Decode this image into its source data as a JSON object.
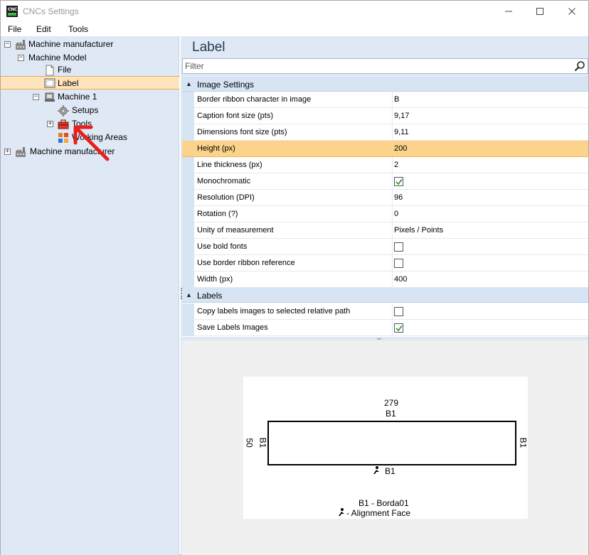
{
  "window": {
    "title": "CNCs Settings",
    "app_icon_text": "CNC",
    "controls": [
      "minimize",
      "maximize",
      "close"
    ]
  },
  "menu": {
    "items": [
      {
        "label": "File"
      },
      {
        "label": "Edit"
      },
      {
        "label": "Tools"
      }
    ]
  },
  "tree": {
    "nodes": [
      {
        "label": "Machine manufacturer",
        "expander": "−",
        "icon": "factory-icon"
      },
      {
        "label": "Machine Model",
        "expander": "−"
      },
      {
        "label": "File",
        "icon": "file-icon"
      },
      {
        "label": "Label",
        "icon": "label-icon",
        "selected": true
      },
      {
        "label": "Machine 1",
        "expander": "−",
        "icon": "machine-icon"
      },
      {
        "label": "Setups",
        "icon": "gear-icon"
      },
      {
        "label": "Tools",
        "expander": "+",
        "icon": "toolbox-icon"
      },
      {
        "label": "Working Areas",
        "icon": "working-areas-icon"
      },
      {
        "label": "Machine manufacturer",
        "expander": "+",
        "icon": "factory-icon"
      }
    ]
  },
  "panel": {
    "title": "Label",
    "filter_placeholder": "Filter"
  },
  "property_grid": {
    "categories": [
      {
        "name": "Image Settings",
        "properties": [
          {
            "name": "Border ribbon character in image",
            "value": "B"
          },
          {
            "name": "Caption font size (pts)",
            "value": "9,17"
          },
          {
            "name": "Dimensions font size (pts)",
            "value": "9,11"
          },
          {
            "name": "Height (px)",
            "value": "200",
            "highlighted": true
          },
          {
            "name": "Line thickness (px)",
            "value": "2"
          },
          {
            "name": "Monochromatic",
            "checkbox": true,
            "checked": true
          },
          {
            "name": "Resolution (DPI)",
            "value": "96"
          },
          {
            "name": "Rotation (?)",
            "value": "0"
          },
          {
            "name": "Unity of measurement",
            "value": "Pixels / Points"
          },
          {
            "name": "Use bold fonts",
            "checkbox": true,
            "checked": false
          },
          {
            "name": "Use border ribbon reference",
            "checkbox": true,
            "checked": false
          },
          {
            "name": "Width (px)",
            "value": "400"
          }
        ]
      },
      {
        "name": "Labels",
        "properties": [
          {
            "name": "Copy labels images to selected relative path",
            "checkbox": true,
            "checked": false
          },
          {
            "name": "Save Labels Images",
            "checkbox": true,
            "checked": true
          }
        ]
      }
    ]
  },
  "preview": {
    "width_dim": "279",
    "top_ribbon": "B1",
    "height_dim": "50",
    "left_ribbon": "B1",
    "right_ribbon": "B1",
    "bottom_ribbon": "B1",
    "caption": "B1 - Borda01",
    "alignment": "- Alignment Face"
  },
  "colors": {
    "panel_bg": "#dfe8f5",
    "selected_bg": "#fde4bd",
    "highlight_row": "#fbd38a",
    "checkbox_green": "#3a9a3a",
    "annotation_red": "#e8201c"
  }
}
